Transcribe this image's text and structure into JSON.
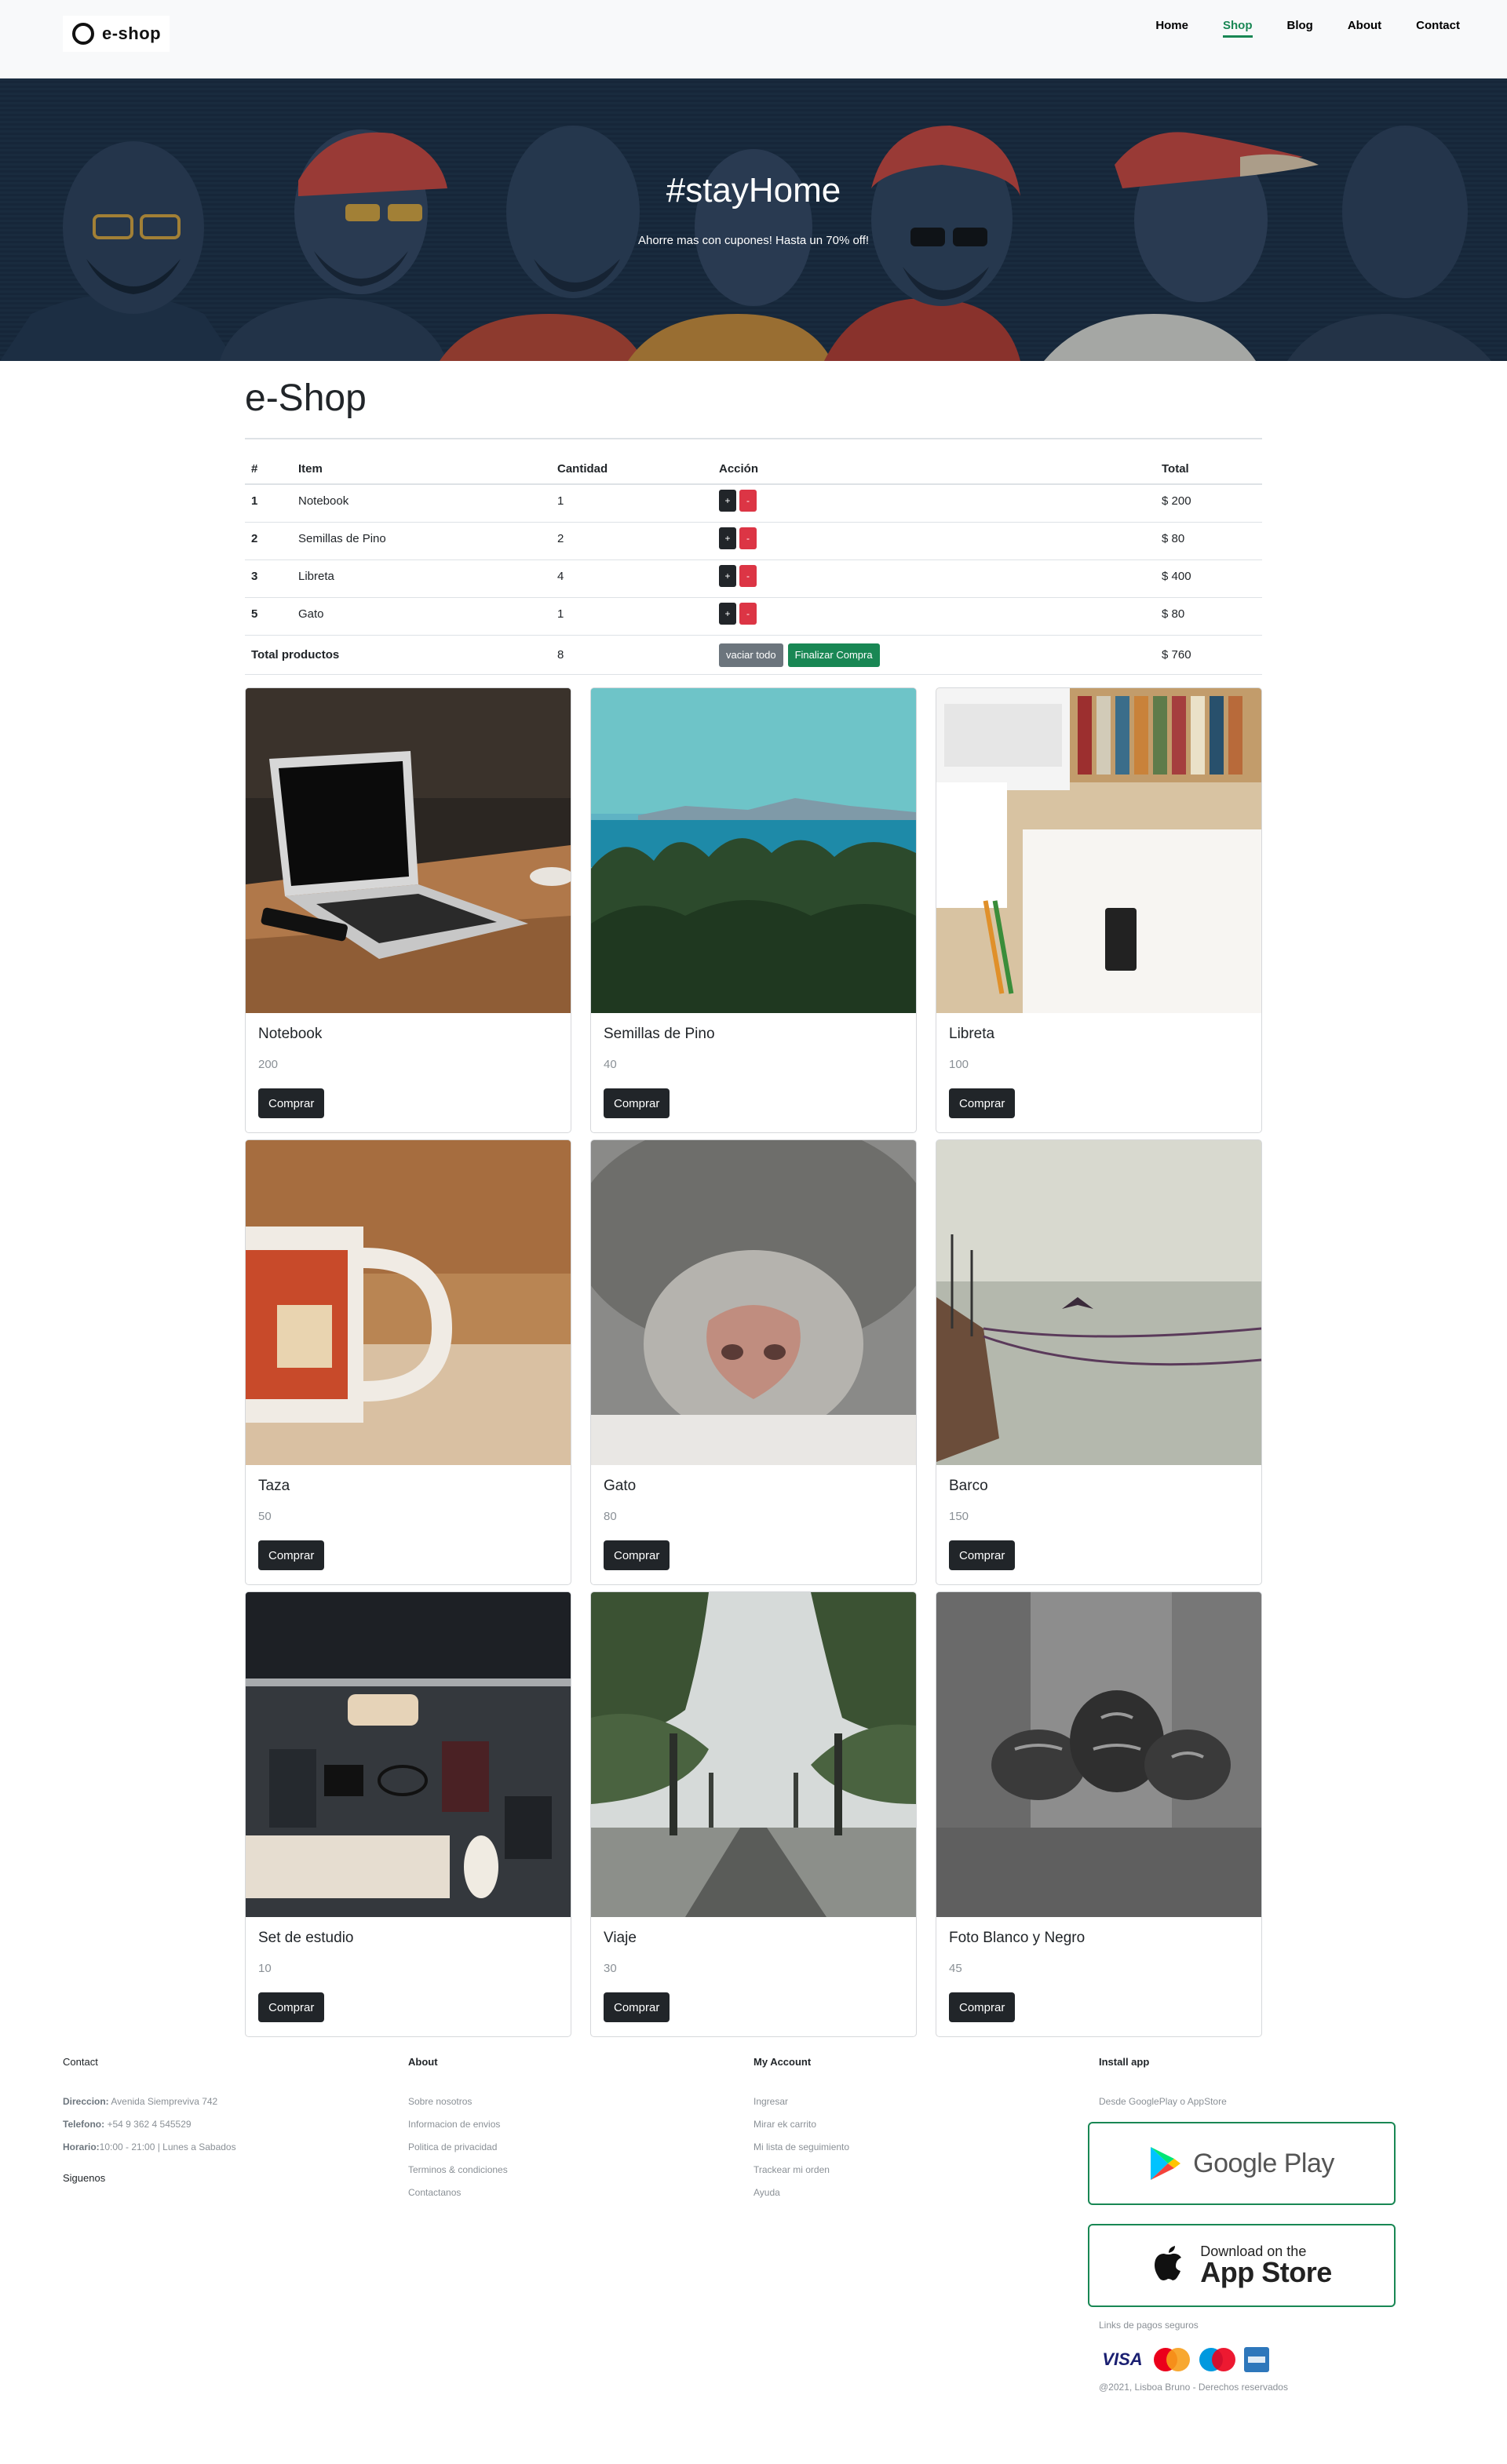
{
  "navbar": {
    "brand": "e-shop",
    "links": [
      {
        "label": "Home",
        "active": false
      },
      {
        "label": "Shop",
        "active": true
      },
      {
        "label": "Blog",
        "active": false
      },
      {
        "label": "About",
        "active": false
      },
      {
        "label": "Contact",
        "active": false
      }
    ],
    "accent_color": "#198754"
  },
  "hero": {
    "title": "#stayHome",
    "subtitle": "Ahorre mas con cupones! Hasta un 70% off!"
  },
  "shop": {
    "title": "e-Shop",
    "cart": {
      "headers": [
        "#",
        "Item",
        "Cantidad",
        "Acción",
        "Total"
      ],
      "rows": [
        {
          "id": "1",
          "item": "Notebook",
          "qty": "1",
          "total": "$ 200"
        },
        {
          "id": "2",
          "item": "Semillas de Pino",
          "qty": "2",
          "total": "$ 80"
        },
        {
          "id": "3",
          "item": "Libreta",
          "qty": "4",
          "total": "$ 400"
        },
        {
          "id": "5",
          "item": "Gato",
          "qty": "1",
          "total": "$ 80"
        }
      ],
      "add_label": "+",
      "remove_label": "-",
      "total_label": "Total productos",
      "total_qty": "8",
      "empty_label": "vaciar todo",
      "checkout_label": "Finalizar Compra",
      "total_amount": "$ 760"
    },
    "products": [
      {
        "name": "Notebook",
        "price": "200",
        "button": "Comprar"
      },
      {
        "name": "Semillas de Pino",
        "price": "40",
        "button": "Comprar"
      },
      {
        "name": "Libreta",
        "price": "100",
        "button": "Comprar"
      },
      {
        "name": "Taza",
        "price": "50",
        "button": "Comprar"
      },
      {
        "name": "Gato",
        "price": "80",
        "button": "Comprar"
      },
      {
        "name": "Barco",
        "price": "150",
        "button": "Comprar"
      },
      {
        "name": "Set de estudio",
        "price": "10",
        "button": "Comprar"
      },
      {
        "name": "Viaje",
        "price": "30",
        "button": "Comprar"
      },
      {
        "name": "Foto Blanco y Negro",
        "price": "45",
        "button": "Comprar"
      }
    ]
  },
  "footer": {
    "contact": {
      "heading": "Contact",
      "address_label": "Direccion:",
      "address": "Avenida Siempreviva 742",
      "phone_label": "Telefono:",
      "phone": "+54 9 362 4 545529",
      "hours_label": "Horario:",
      "hours": "10:00 - 21:00 | Lunes a Sabados",
      "follow": "Siguenos"
    },
    "about": {
      "heading": "About",
      "links": [
        "Sobre nosotros",
        "Informacion de envios",
        "Politica de privacidad",
        "Terminos & condiciones",
        "Contactanos"
      ]
    },
    "account": {
      "heading": "My Account",
      "links": [
        "Ingresar",
        "Mirar ek carrito",
        "Mi lista de seguimiento",
        "Trackear mi orden",
        "Ayuda"
      ]
    },
    "install": {
      "heading": "Install app",
      "subtitle": "Desde GooglePlay o AppStore",
      "google_play": "Google Play",
      "app_store_small": "Download on the",
      "app_store_big": "App Store",
      "payments_label": "Links de pagos seguros",
      "payments": [
        "VISA",
        "MasterCard",
        "Maestro",
        "American Express"
      ],
      "copyright": "@2021, Lisboa Bruno - Derechos reservados"
    }
  }
}
